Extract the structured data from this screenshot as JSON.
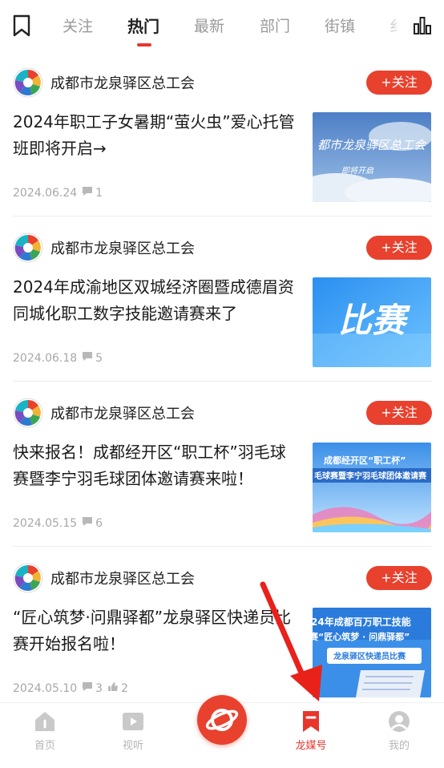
{
  "tabs": [
    {
      "label": "关注"
    },
    {
      "label": "热门"
    },
    {
      "label": "最新"
    },
    {
      "label": "部门"
    },
    {
      "label": "街镇"
    },
    {
      "label": "纟"
    }
  ],
  "active_tab": "热门",
  "feed": [
    {
      "author": "成都市龙泉驿区总工会",
      "follow_label": "+关注",
      "title": "2024年职工子女暑期“萤火虫”爱心托管班即将开启→",
      "date": "2024.06.24",
      "comments": "1",
      "thumb_text_1": "都市龙泉驿区总工会",
      "thumb_text_2": "即将开启"
    },
    {
      "author": "成都市龙泉驿区总工会",
      "follow_label": "+关注",
      "title": "2024年成渝地区双城经济圈暨成德眉资同城化职工数字技能邀请赛来了",
      "date": "2024.06.18",
      "comments": "5",
      "thumb_text_1": "比赛"
    },
    {
      "author": "成都市龙泉驿区总工会",
      "follow_label": "+关注",
      "title": "快来报名！成都经开区“职工杯”羽毛球赛暨李宁羽毛球团体邀请赛来啦！",
      "date": "2024.05.15",
      "comments": "6",
      "thumb_text_1": "成都经开区“职工杯”",
      "thumb_text_2": "毛球赛暨李宁羽毛球团体邀请赛"
    },
    {
      "author": "成都市龙泉驿区总工会",
      "follow_label": "+关注",
      "title": "“匠心筑梦·问鼎驿都”龙泉驿区快递员比赛开始报名啦！",
      "date": "2024.05.10",
      "comments": "3",
      "likes": "2",
      "thumb_text_1": "24年成都百万职工技能",
      "thumb_text_2": "赛“匠心筑梦 · 问鼎驿都”",
      "thumb_text_3": "龙泉驿区快递员比赛"
    }
  ],
  "bottom_nav": {
    "home": "首页",
    "video": "视听",
    "longmei": "龙媒号",
    "mine": "我的"
  },
  "colors": {
    "accent": "#e8362d",
    "follow": "#e8412e"
  }
}
